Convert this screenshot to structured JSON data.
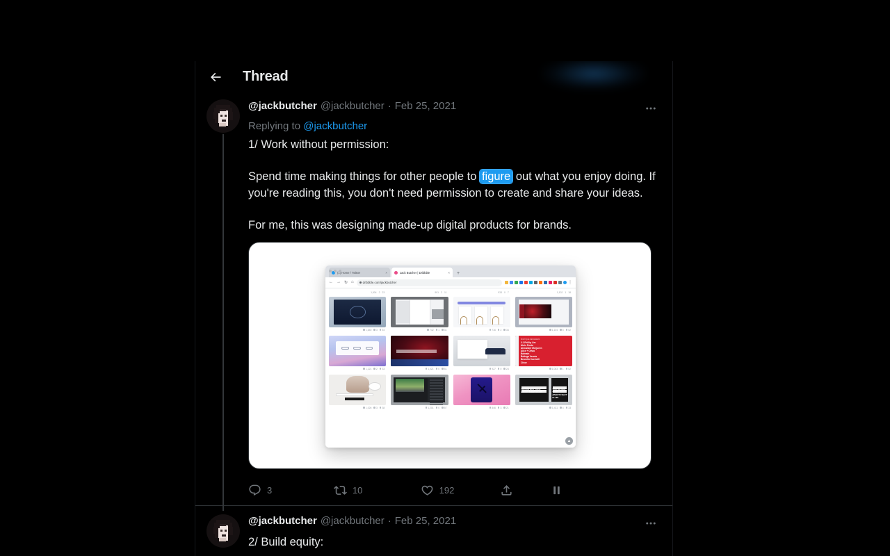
{
  "window": {
    "background": "#000000"
  },
  "header": {
    "title": "Thread",
    "back_icon": "arrow-left-icon"
  },
  "colors": {
    "accent": "#1d9bf0",
    "text_primary": "#e7e9ea",
    "text_muted": "#71767b",
    "border": "#2f3336",
    "thread_line": "#333639"
  },
  "tweets": [
    {
      "display_name": "@jackbutcher",
      "handle": "@jackbutcher",
      "separator": "·",
      "date": "Feb 25, 2021",
      "replying_prefix": "Replying to ",
      "replying_to": "@jackbutcher",
      "text_line1": "1/ Work without permission:",
      "text_before_selection": "Spend time making things for other people to ",
      "selected_word": "figure",
      "text_after_selection": " out what you enjoy doing. If you're reading this, you don't need permission to create and share your ideas.",
      "text_paragraph3": "For me, this was designing made-up digital products for brands.",
      "more_icon": "ellipsis-icon",
      "actions": {
        "reply": {
          "icon": "reply-icon",
          "count": "3"
        },
        "retweet": {
          "icon": "retweet-icon",
          "count": "10"
        },
        "like": {
          "icon": "heart-icon",
          "count": "192"
        },
        "share": {
          "icon": "share-icon",
          "count": ""
        },
        "bookmark": {
          "icon": "pause-icon",
          "count": ""
        }
      },
      "media": {
        "type": "screenshot-image",
        "alt": "Browser window showing a Dribbble portfolio grid",
        "browser": {
          "tabs": [
            {
              "favicon": "twitter-icon",
              "label": "(1) Home / Twitter",
              "close": "×",
              "active": false
            },
            {
              "favicon": "dribbble-icon",
              "label": "Jack Butcher | Dribbble",
              "close": "×",
              "active": true
            }
          ],
          "new_tab_label": "+",
          "nav": {
            "back": "←",
            "forward": "→",
            "reload": "↻",
            "home": "⌂"
          },
          "url": "dribbble.com/jackbutcher",
          "menu_icon": "kebab-menu-icon",
          "fab_label": "▲"
        },
        "shots": [
          {
            "name": "dark-dashboard-ui",
            "art": "t1",
            "views": "1,640",
            "comments": "3",
            "likes": "54"
          },
          {
            "name": "document-editor-ui",
            "art": "t2",
            "views": "742",
            "comments": "1",
            "likes": "31"
          },
          {
            "name": "headphones-store-ui",
            "art": "t3",
            "views": "716",
            "comments": "2",
            "likes": "34"
          },
          {
            "name": "photo-gallery-ui",
            "art": "t4",
            "views": "1,104",
            "comments": "5",
            "likes": "52"
          },
          {
            "name": "smart-home-ui",
            "art": "t5",
            "views": "1,121",
            "comments": "2",
            "likes": "33"
          },
          {
            "name": "laguna-seca-poster",
            "art": "t6",
            "views": "1,021",
            "comments": "0",
            "likes": "51"
          },
          {
            "name": "car-brochure-ui",
            "art": "t7",
            "views": "927",
            "comments": "0",
            "likes": "24"
          },
          {
            "name": "brand-list-red",
            "art": "t8",
            "views": "1,063",
            "comments": "1",
            "likes": "52"
          },
          {
            "name": "fashion-ecommerce",
            "art": "t9",
            "views": "1,026",
            "comments": "3",
            "likes": "38"
          },
          {
            "name": "motorsport-dashboard",
            "art": "t10",
            "views": "1,201",
            "comments": "0",
            "likes": "57"
          },
          {
            "name": "airline-app",
            "art": "t11",
            "views": "846",
            "comments": "3",
            "likes": "21"
          },
          {
            "name": "fight-club-posters",
            "art": "t12",
            "views": "1,411",
            "comments": "4",
            "likes": "33"
          }
        ],
        "brand_list": {
          "kicker": "BOUTIQUE DESIGNERS",
          "lines": [
            "3.1 Phillip Lim",
            "Akris Punto",
            "Alexander McQueen",
            "Alice + Olivia",
            "Balmain",
            "Bottega Veneta",
            "Brunello Cucinelli",
            "Chloe"
          ]
        },
        "poster_text": {
          "line1": "YOU DO NOT TALK",
          "line2": "ABOUT FIGHT CLUB."
        }
      }
    },
    {
      "display_name": "@jackbutcher",
      "handle": "@jackbutcher",
      "separator": "·",
      "date": "Feb 25, 2021",
      "text_line1": "2/ Build equity:",
      "more_icon": "ellipsis-icon"
    }
  ]
}
